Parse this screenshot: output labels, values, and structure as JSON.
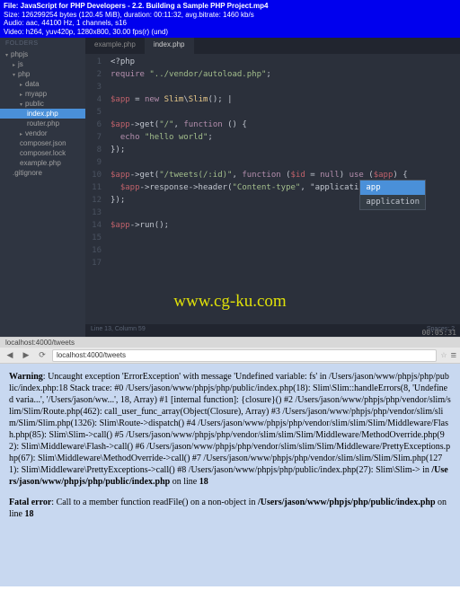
{
  "video": {
    "file": "File: JavaScript for PHP Developers - 2.2. Building a Sample PHP Project.mp4",
    "size": "Size: 126299254 bytes (120.45 MiB), duration: 00:11:32, avg.bitrate: 1460 kb/s",
    "audio": "Audio: aac, 44100 Hz, 1 channels, s16",
    "videoCodec": "Video: h264, yuv420p, 1280x800, 30.00 fps(r) (und)"
  },
  "sidebar": {
    "header": "FOLDERS",
    "items": [
      {
        "label": "phpjs",
        "indent": 0,
        "folder": true,
        "open": true
      },
      {
        "label": "js",
        "indent": 1,
        "folder": true
      },
      {
        "label": "php",
        "indent": 1,
        "folder": true,
        "open": true
      },
      {
        "label": "data",
        "indent": 2,
        "folder": true
      },
      {
        "label": "myapp",
        "indent": 2,
        "folder": true
      },
      {
        "label": "public",
        "indent": 2,
        "folder": true,
        "open": true
      },
      {
        "label": "index.php",
        "indent": 3,
        "selected": true
      },
      {
        "label": "router.php",
        "indent": 3
      },
      {
        "label": "vendor",
        "indent": 2,
        "folder": true
      },
      {
        "label": "composer.json",
        "indent": 2
      },
      {
        "label": "composer.lock",
        "indent": 2
      },
      {
        "label": "example.php",
        "indent": 2
      },
      {
        "label": ".gitignore",
        "indent": 1
      }
    ]
  },
  "tabs": [
    {
      "label": "example.php",
      "active": false
    },
    {
      "label": "index.php",
      "active": true
    }
  ],
  "code_plain": "<?php\nrequire \"../vendor/autoload.php\";\n\n$app = new Slim\\Slim(); |\n\n$app->get(\"/\", function () {\n  echo \"hello world\";\n});\n\n$app->get(\"/tweets(/:id)\", function ($id = null) use ($app) {\n  $app->response->header(\"Content-type\", \"applicatio\n});\n\n$app->run();",
  "autocomplete": {
    "items": [
      {
        "label": "app"
      },
      {
        "label": "application"
      }
    ]
  },
  "statusbar": {
    "left": "Line 13, Column 59",
    "right": "Spaces: 2"
  },
  "timecode": "00:05:31",
  "watermark": "www.cg-ku.com",
  "browser": {
    "tabTitle": "localhost:4000/tweets",
    "url": "localhost:4000/tweets",
    "nav": {
      "back": "◀",
      "fwd": "▶",
      "reload": "⟳"
    },
    "hamburger": "≡"
  },
  "error": {
    "warningLabel": "Warning",
    "warningText": ": Uncaught exception 'ErrorException' with message 'Undefined variable: fs' in /Users/jason/www/phpjs/php/public/index.php:18 Stack trace: #0 /Users/jason/www/phpjs/php/public/index.php(18): Slim\\Slim::handleErrors(8, 'Undefined varia...', '/Users/jason/ww...', 18, Array) #1 [internal function]: {closure}() #2 /Users/jason/www/phpjs/php/vendor/slim/slim/Slim/Route.php(462): call_user_func_array(Object(Closure), Array) #3 /Users/jason/www/phpjs/php/vendor/slim/slim/Slim/Slim.php(1326): Slim\\Route->dispatch() #4 /Users/jason/www/phpjs/php/vendor/slim/slim/Slim/Middleware/Flash.php(85): Slim\\Slim->call() #5 /Users/jason/www/phpjs/php/vendor/slim/slim/Slim/Middleware/MethodOverride.php(92): Slim\\Middleware\\Flash->call() #6 /Users/jason/www/phpjs/php/vendor/slim/slim/Slim/Middleware/PrettyExceptions.php(67): Slim\\Middleware\\MethodOverride->call() #7 /Users/jason/www/phpjs/php/vendor/slim/slim/Slim/Slim.php(1271): Slim\\Middleware\\PrettyExceptions->call() #8 /Users/jason/www/phpjs/php/public/index.php(27): Slim\\Slim-> in ",
    "warningFile": "/Users/jason/www/phpjs/php/public/index.php",
    "onLineLabel": " on line ",
    "warningLine": "18",
    "fatalLabel": "Fatal error",
    "fatalText": ": Call to a member function readFile() on a non-object in ",
    "fatalFile": "/Users/jason/www/phpjs/php/public/index.php",
    "fatalLine": "18"
  }
}
